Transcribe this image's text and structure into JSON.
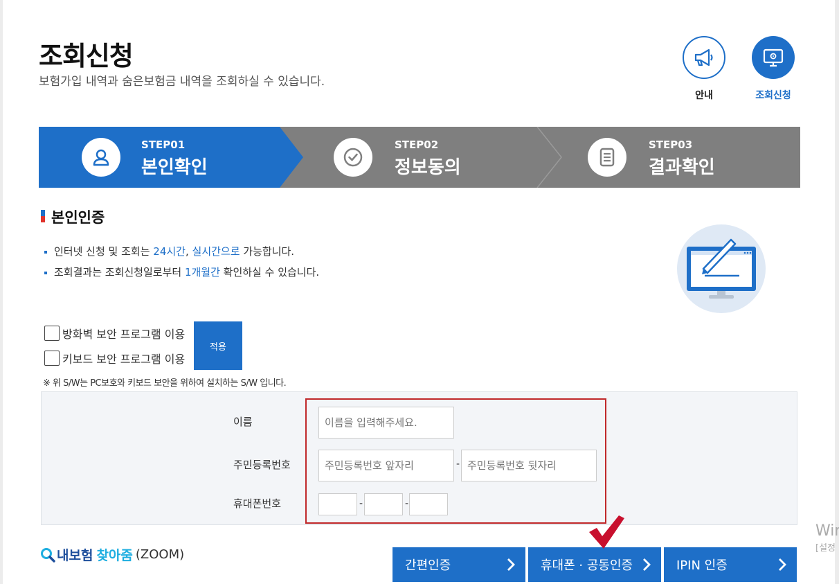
{
  "header": {
    "title": "조회신청",
    "subtitle": "보험가입 내역과 숨은보험금 내역을 조회하실 수 있습니다."
  },
  "top_icons": {
    "guide_label": "안내",
    "apply_label": "조회신청"
  },
  "steps": [
    {
      "no": "STEP01",
      "name": "본인확인",
      "active": true
    },
    {
      "no": "STEP02",
      "name": "정보동의",
      "active": false
    },
    {
      "no": "STEP03",
      "name": "결과확인",
      "active": false
    }
  ],
  "section": {
    "title": "본인인증"
  },
  "notices": [
    {
      "pre": "인터넷 신청 및 조회는 ",
      "hl1": "24시간",
      "mid": ", ",
      "hl2": "실시간으로",
      "post": " 가능합니다."
    },
    {
      "pre": "조회결과는 조회신청일로부터 ",
      "hl1": "1개월간",
      "post": " 확인하실 수 있습니다."
    }
  ],
  "security": {
    "firewall_label": "방화벽 보안 프로그램 이용",
    "keyboard_label": "키보드 보안 프로그램 이용",
    "apply_button": "적용",
    "note": "※ 위 S/W는 PC보호와 키보드 보안을 위하여 설치하는 S/W 입니다."
  },
  "form": {
    "name_label": "이름",
    "name_placeholder": "이름을 입력해주세요.",
    "rrn_label": "주민등록번호",
    "rrn_front_placeholder": "주민등록번호 앞자리",
    "rrn_back_placeholder": "주민등록번호 뒷자리",
    "phone_label": "휴대폰번호",
    "dash": "-"
  },
  "zoom": {
    "part1": "내보험",
    "part2": "찾아줌",
    "part3": "(ZOOM)"
  },
  "auth_buttons": [
    {
      "label": "간편인증"
    },
    {
      "label": "휴대폰 · 공동인증"
    },
    {
      "label": "IPIN 인증"
    }
  ],
  "os_watermark": {
    "line1": "Win",
    "line2": "[설정"
  },
  "colors": {
    "primary": "#1e6fc8",
    "step_inactive": "#7f7f7f",
    "highlight_border": "#c0282a"
  }
}
